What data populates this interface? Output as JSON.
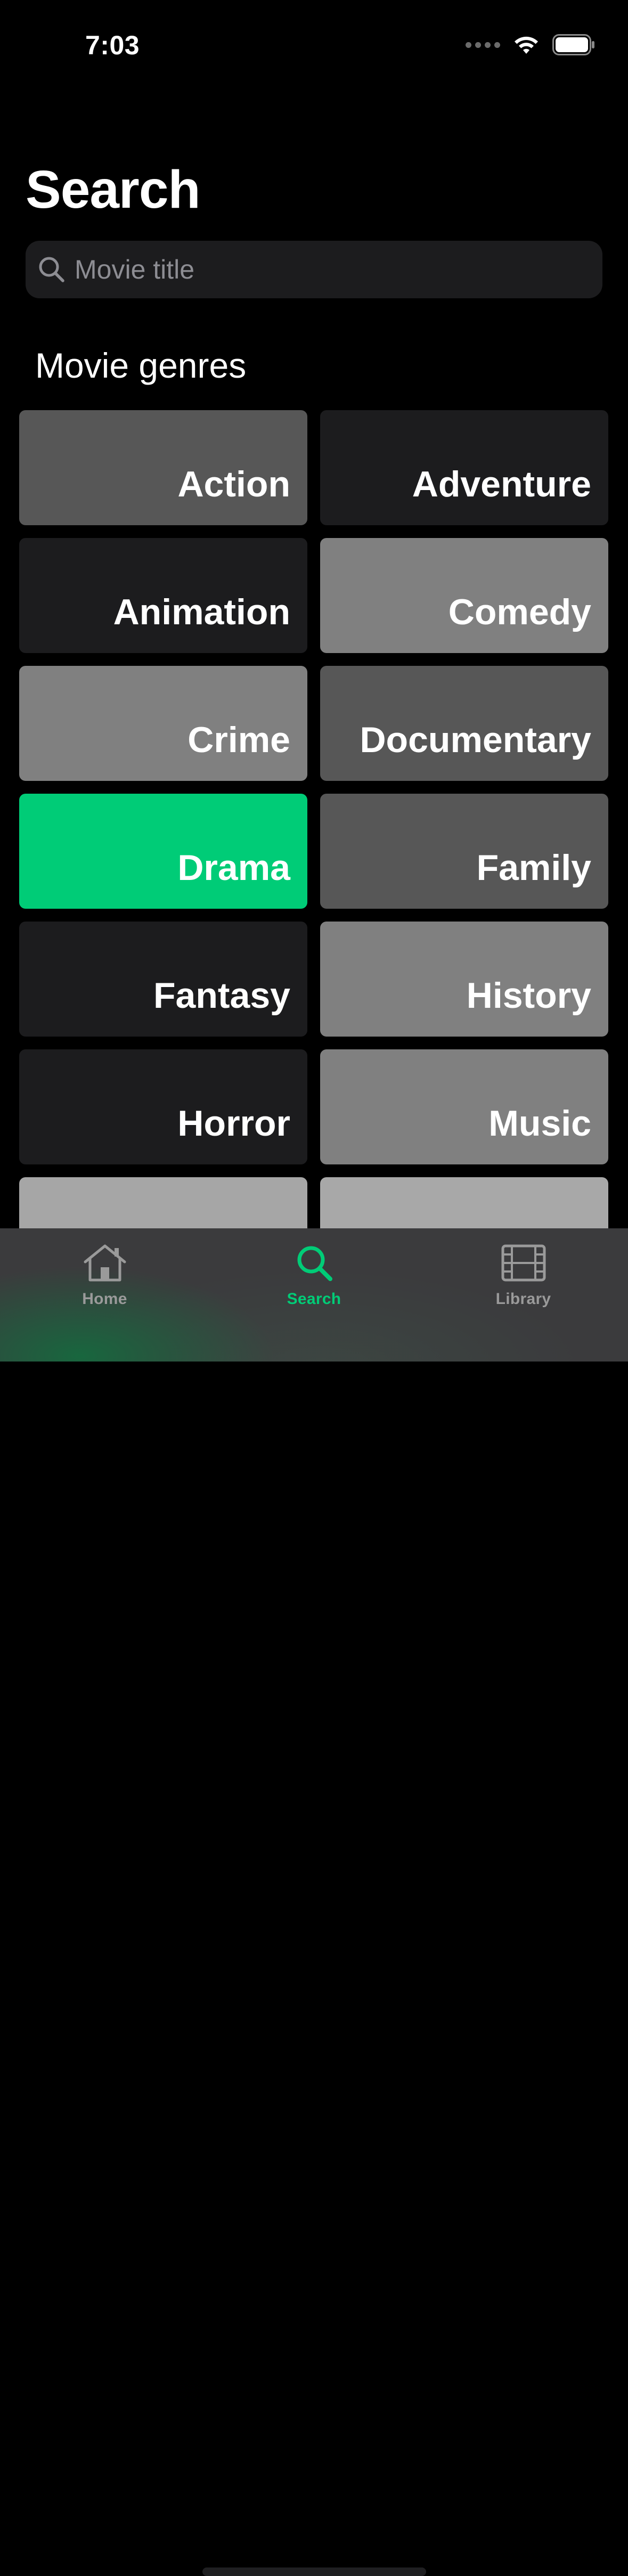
{
  "status_bar": {
    "time": "7:03"
  },
  "page_title": "Search",
  "search": {
    "placeholder": "Movie title",
    "value": ""
  },
  "section_title": "Movie genres",
  "genres": [
    {
      "label": "Action",
      "color": "#575757"
    },
    {
      "label": "Adventure",
      "color": "#1c1c1e"
    },
    {
      "label": "Animation",
      "color": "#1c1c1e"
    },
    {
      "label": "Comedy",
      "color": "#808080"
    },
    {
      "label": "Crime",
      "color": "#808080"
    },
    {
      "label": "Documentary",
      "color": "#575757"
    },
    {
      "label": "Drama",
      "color": "#00cc77"
    },
    {
      "label": "Family",
      "color": "#575757"
    },
    {
      "label": "Fantasy",
      "color": "#1c1c1e"
    },
    {
      "label": "History",
      "color": "#808080"
    },
    {
      "label": "Horror",
      "color": "#1c1c1e"
    },
    {
      "label": "Music",
      "color": "#808080"
    },
    {
      "label": "",
      "color": "#a6a6a6"
    },
    {
      "label": "",
      "color": "#a8a8a8"
    }
  ],
  "tab_bar": {
    "tabs": [
      {
        "label": "Home",
        "icon": "house-icon",
        "active": false
      },
      {
        "label": "Search",
        "icon": "magnifier-icon",
        "active": true
      },
      {
        "label": "Library",
        "icon": "film-icon",
        "active": false
      }
    ]
  },
  "colors": {
    "accent": "#00cc77",
    "inactive_tab": "#9a9a9a",
    "background": "#000000"
  }
}
